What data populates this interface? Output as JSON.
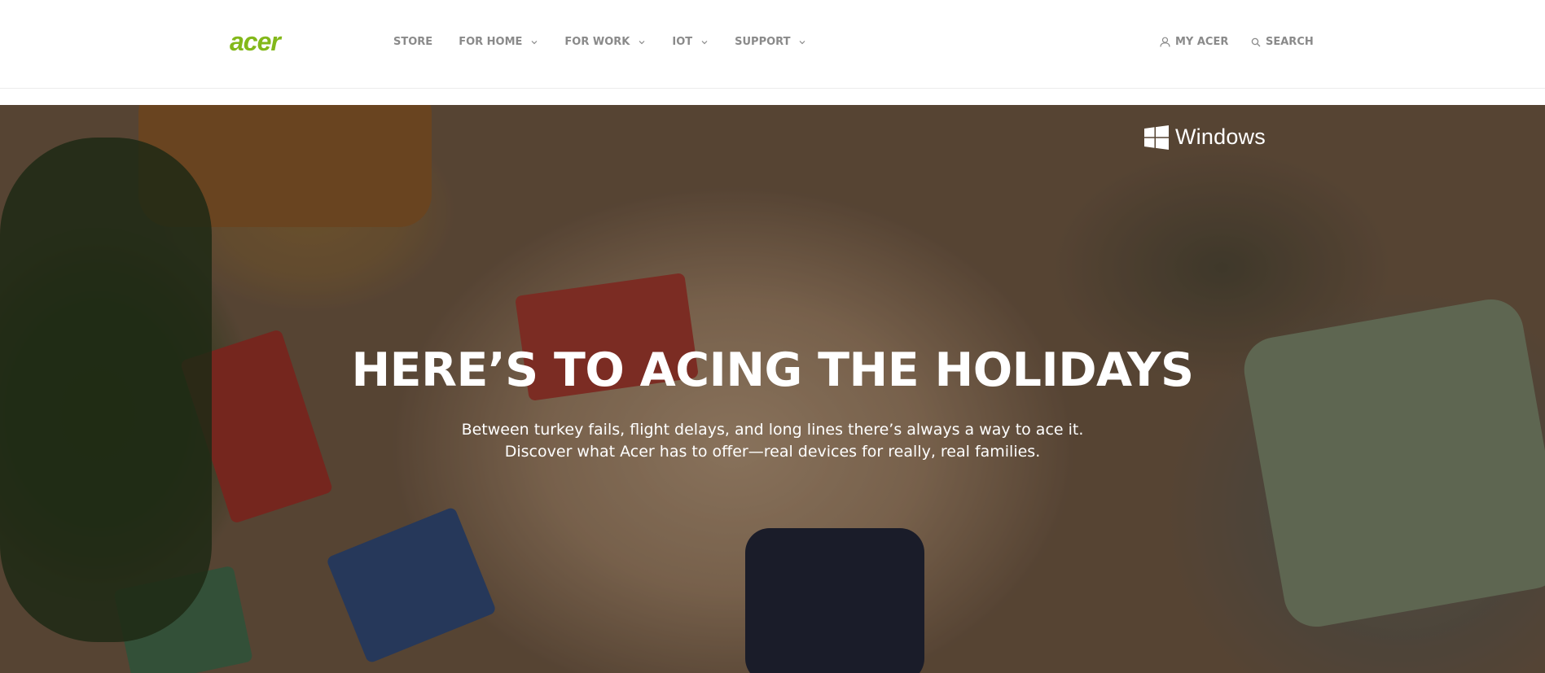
{
  "brand": {
    "logo_text": "acer",
    "accent_color": "#83b81a"
  },
  "nav": {
    "items": [
      {
        "label": "STORE",
        "has_dropdown": false
      },
      {
        "label": "FOR HOME",
        "has_dropdown": true
      },
      {
        "label": "FOR WORK",
        "has_dropdown": true
      },
      {
        "label": "IOT",
        "has_dropdown": true
      },
      {
        "label": "SUPPORT",
        "has_dropdown": true
      }
    ]
  },
  "utility": {
    "my_acer": {
      "label": "MY ACER",
      "icon": "user-icon"
    },
    "search": {
      "label": "SEARCH",
      "icon": "search-icon"
    }
  },
  "hero": {
    "partner_logo": {
      "text": "Windows",
      "icon": "windows-logo-icon"
    },
    "headline": "HERE’S TO ACING THE HOLIDAYS",
    "subtext_line1": "Between turkey fails, flight delays, and long lines there’s always a way to ace it.",
    "subtext_line2": "Discover what Acer has to offer—real devices for really, real families."
  }
}
